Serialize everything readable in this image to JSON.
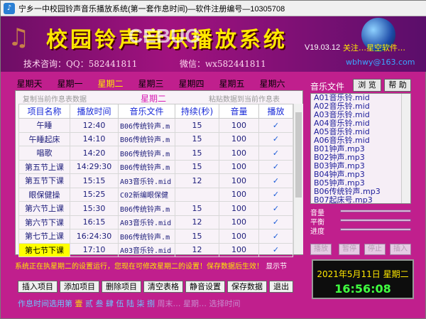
{
  "window": {
    "title": "宁乡一中校园铃声音乐播放系统(第一套作息时间)—软件注册编号—10305708"
  },
  "banner": {
    "headline": "校园铃声音乐播放系统",
    "version": "V19.03.12",
    "tech": "技术咨询：QQ：582441811",
    "wechat": "微信：wx582441811",
    "follow": "关注…星空软件…",
    "email": "wbhwy@163.com",
    "watermark": "CEBUG"
  },
  "days": [
    "星期天",
    "星期一",
    "星期二",
    "星期三",
    "星期四",
    "星期五",
    "星期六"
  ],
  "active_day_index": 2,
  "panel": {
    "copy_label": "复制当前作息表数据",
    "day_name": "星期二",
    "paste_label": "粘贴数据到当前作息表"
  },
  "table": {
    "headers": [
      "项目名称",
      "播放时间",
      "音乐文件",
      "持续(秒)",
      "音量",
      "播放"
    ],
    "rows": [
      {
        "name": "午睡",
        "time": "12:40",
        "file": "B06传统铃声.m",
        "duration": "15",
        "volume": "100",
        "play": "✓"
      },
      {
        "name": "午睡起床",
        "time": "14:10",
        "file": "B06传统铃声.m",
        "duration": "15",
        "volume": "100",
        "play": "✓"
      },
      {
        "name": "唱歌",
        "time": "14:20",
        "file": "B06传统铃声.m",
        "duration": "15",
        "volume": "100",
        "play": "✓"
      },
      {
        "name": "第五节上课",
        "time": "14:29:30",
        "file": "B06传统铃声.m",
        "duration": "15",
        "volume": "100",
        "play": "✓"
      },
      {
        "name": "第五节下课",
        "time": "15:15",
        "file": "A03音乐铃.mid",
        "duration": "12",
        "volume": "100",
        "play": "✓"
      },
      {
        "name": "眼保健操",
        "time": "15:25",
        "file": "C02新编眼保健",
        "duration": "",
        "volume": "100",
        "play": "✓"
      },
      {
        "name": "第六节上课",
        "time": "15:30",
        "file": "B06传统铃声.m",
        "duration": "15",
        "volume": "100",
        "play": "✓"
      },
      {
        "name": "第六节下课",
        "time": "16:15",
        "file": "A03音乐铃.mid",
        "duration": "12",
        "volume": "100",
        "play": "✓"
      },
      {
        "name": "第七节上课",
        "time": "16:24:30",
        "file": "B06传统铃声.m",
        "duration": "15",
        "volume": "100",
        "play": "✓"
      },
      {
        "name": "第七节下课",
        "time": "17:10",
        "file": "A03音乐铃.mid",
        "duration": "12",
        "volume": "100",
        "play": "✓"
      }
    ]
  },
  "music": {
    "label": "音乐文件",
    "browse": "浏 览",
    "help": "帮 助",
    "files": [
      "A01音乐铃.mid",
      "A02音乐铃.mid",
      "A03音乐铃.mid",
      "A04音乐铃.mid",
      "A05音乐铃.mid",
      "A06音乐铃.mid",
      "B01钟声.mp3",
      "B02钟声.mp3",
      "B03钟声.mp3",
      "B04钟声.mp3",
      "B05钟声.mp3",
      "B06传统铃声.mp3",
      "B07起床号.mp3"
    ]
  },
  "sliders": {
    "volume": "音量",
    "balance": "平衡",
    "progress": "进度"
  },
  "controls": {
    "play": "播放",
    "pause": "暂停",
    "stop": "停止",
    "insert": "插入"
  },
  "status": {
    "text": "系统正在执星期二的设置运行，您现在可修改星期二的设置！保存数据后生效！",
    "tail": "显示节"
  },
  "clock": {
    "date": "2021年5月11日 星期二",
    "time": "16:56:08"
  },
  "buttons": [
    "插入项目",
    "添加项目",
    "删除项目",
    "清空表格",
    "静音设置",
    "保存数据",
    "退出"
  ],
  "footer": {
    "prefix": "作息时间选用第",
    "selected": "壹",
    "rest": "贰 叁 肆 伍 陆 柒 捌",
    "tail": "周末…  星期…  选择时间"
  }
}
